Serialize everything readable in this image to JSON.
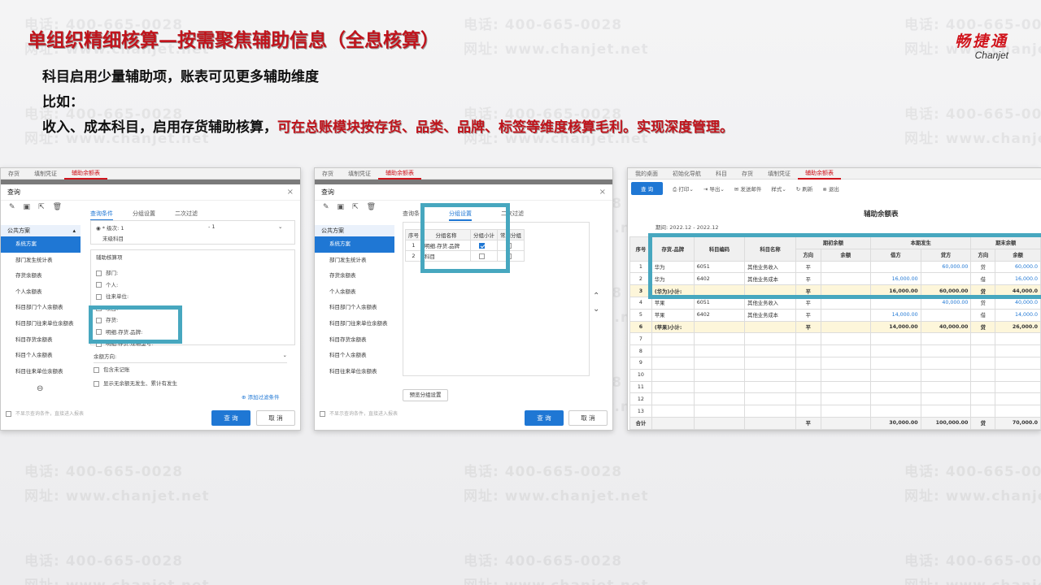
{
  "slide": {
    "title": "单组织精细核算—按需聚焦辅助信息（全息核算）",
    "logo_cn": "畅捷通",
    "logo_en": "Chanjet",
    "line1": "科目启用少量辅助项，账表可见更多辅助维度",
    "line2": "比如：",
    "line3_black": "收入、成本科目，启用存货辅助核算，",
    "line3_red": "可在总账模块按存货、品类、品牌、标签等维度核算毛利。实现深度管理。",
    "watermark_tel": "电话: 400-665-0028",
    "watermark_url": "网址: www.chanjet.net"
  },
  "panel1": {
    "tabs": [
      "存货",
      "填制凭证",
      "辅助余额表"
    ],
    "dialog_title": "查询",
    "close": "×",
    "scheme_header": "公共方案",
    "schemes": [
      "系统方案",
      "部门发生统计表",
      "存货余额表",
      "个人余额表",
      "科目部门个人余额表",
      "科目部门往来单位余额表",
      "科目存货余额表",
      "科目个人余额表",
      "科目往来单位余额表"
    ],
    "subtabs": [
      "查询条件",
      "分组设置",
      "二次过滤"
    ],
    "level_label": "* 级次: 1",
    "level_to": "- 1",
    "end_subject": "末级科目",
    "aux_title": "辅助核算项",
    "aux_items": [
      "部门:",
      "个人:",
      "往来单位:",
      "项目:",
      "存货:",
      "明细.存货.品牌:",
      "明细.存货.规格型号:"
    ],
    "balance_dir": "余额方向:",
    "opt1": "包含未记账",
    "opt2": "显示无余额无发生、累计有发生",
    "add_filter": "添加过滤条件",
    "footer_note": "不显示查询条件，直接进入报表",
    "query_btn": "查 询",
    "cancel_btn": "取 消"
  },
  "panel2": {
    "tabs": [
      "存货",
      "填制凭证",
      "辅助余额表"
    ],
    "dialog_title": "查询",
    "close": "×",
    "scheme_header": "公共方案",
    "schemes": [
      "系统方案",
      "部门发生统计表",
      "存货余额表",
      "个人余额表",
      "科目部门个人余额表",
      "科目部门往来单位余额表",
      "科目存货余额表",
      "科目个人余额表",
      "科目往来单位余额表"
    ],
    "subtabs": [
      "查询条",
      "分组设置",
      "二次过滤"
    ],
    "grid_headers": [
      "序号",
      "分组名称",
      "分组小计",
      "常用分组"
    ],
    "grid_rows": [
      {
        "no": "1",
        "name": "明细.存货.品牌",
        "checked": true
      },
      {
        "no": "2",
        "name": "科目",
        "checked": false
      }
    ],
    "preview_btn": "预览分组设置",
    "footer_note": "不显示查询条件，直接进入报表",
    "query_btn": "查 询",
    "cancel_btn": "取 消"
  },
  "panel3": {
    "tabs": [
      "我的桌面",
      "初始化导航",
      "科目",
      "存货",
      "填制凭证",
      "辅助余额表"
    ],
    "toolbar": [
      "查 询",
      "打印",
      "导出",
      "发送邮件",
      "样式",
      "刷新",
      "退出"
    ],
    "report_title": "辅助余额表",
    "period": "期间: 2022.12 - 2022.12",
    "headers_top": [
      "序号",
      "存货.品牌",
      "科目编码",
      "科目名称",
      "期初余额",
      "本期发生",
      "期末余额"
    ],
    "headers_sub": [
      "方向",
      "余额",
      "借方",
      "贷方",
      "方向",
      "余额"
    ],
    "rows": [
      {
        "no": "1",
        "brand": "华为",
        "code": "6051",
        "name": "其他业务收入",
        "dir1": "平",
        "bal1": "",
        "debit": "",
        "credit": "60,000.00",
        "dir2": "贷",
        "bal2": "60,000.0",
        "type": "blue-c"
      },
      {
        "no": "2",
        "brand": "华为",
        "code": "6402",
        "name": "其他业务成本",
        "dir1": "平",
        "bal1": "",
        "debit": "16,000.00",
        "credit": "",
        "dir2": "借",
        "bal2": "16,000.0",
        "type": "blue-d"
      },
      {
        "no": "3",
        "brand": "(华为)小计:",
        "code": "",
        "name": "",
        "dir1": "平",
        "bal1": "",
        "debit": "16,000.00",
        "credit": "60,000.00",
        "dir2": "贷",
        "bal2": "44,000.0",
        "type": "sub"
      },
      {
        "no": "4",
        "brand": "苹果",
        "code": "6051",
        "name": "其他业务收入",
        "dir1": "平",
        "bal1": "",
        "debit": "",
        "credit": "40,000.00",
        "dir2": "贷",
        "bal2": "40,000.0",
        "type": "blue-c"
      },
      {
        "no": "5",
        "brand": "苹果",
        "code": "6402",
        "name": "其他业务成本",
        "dir1": "平",
        "bal1": "",
        "debit": "14,000.00",
        "credit": "",
        "dir2": "借",
        "bal2": "14,000.0",
        "type": "blue-d"
      },
      {
        "no": "6",
        "brand": "(苹果)小计:",
        "code": "",
        "name": "",
        "dir1": "平",
        "bal1": "",
        "debit": "14,000.00",
        "credit": "40,000.00",
        "dir2": "贷",
        "bal2": "26,000.0",
        "type": "sub"
      },
      {
        "no": "7",
        "brand": "",
        "code": "",
        "name": "",
        "dir1": "",
        "bal1": "",
        "debit": "",
        "credit": "",
        "dir2": "",
        "bal2": "",
        "type": "empty"
      },
      {
        "no": "8",
        "brand": "",
        "code": "",
        "name": "",
        "dir1": "",
        "bal1": "",
        "debit": "",
        "credit": "",
        "dir2": "",
        "bal2": "",
        "type": "empty"
      },
      {
        "no": "9",
        "brand": "",
        "code": "",
        "name": "",
        "dir1": "",
        "bal1": "",
        "debit": "",
        "credit": "",
        "dir2": "",
        "bal2": "",
        "type": "empty"
      },
      {
        "no": "10",
        "brand": "",
        "code": "",
        "name": "",
        "dir1": "",
        "bal1": "",
        "debit": "",
        "credit": "",
        "dir2": "",
        "bal2": "",
        "type": "empty"
      },
      {
        "no": "11",
        "brand": "",
        "code": "",
        "name": "",
        "dir1": "",
        "bal1": "",
        "debit": "",
        "credit": "",
        "dir2": "",
        "bal2": "",
        "type": "empty"
      },
      {
        "no": "12",
        "brand": "",
        "code": "",
        "name": "",
        "dir1": "",
        "bal1": "",
        "debit": "",
        "credit": "",
        "dir2": "",
        "bal2": "",
        "type": "empty"
      },
      {
        "no": "13",
        "brand": "",
        "code": "",
        "name": "",
        "dir1": "",
        "bal1": "",
        "debit": "",
        "credit": "",
        "dir2": "",
        "bal2": "",
        "type": "empty"
      },
      {
        "no": "合计",
        "brand": "",
        "code": "",
        "name": "",
        "dir1": "平",
        "bal1": "",
        "debit": "30,000.00",
        "credit": "100,000.00",
        "dir2": "贷",
        "bal2": "70,000.0",
        "type": "tot"
      }
    ]
  }
}
